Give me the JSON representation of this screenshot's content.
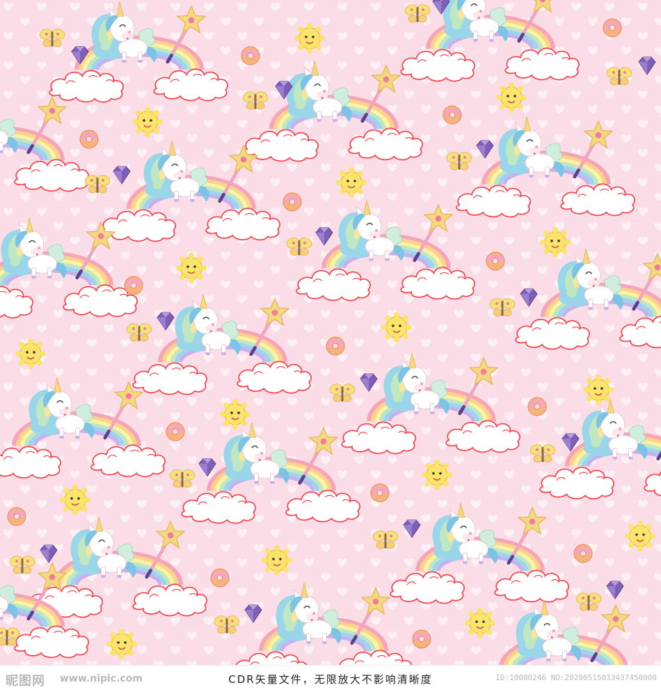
{
  "image": {
    "palette": {
      "background": "#fadde6",
      "heart": "#fdf1f5",
      "cloud_fill": "#ffffff",
      "cloud_outline": "#f04b55",
      "rainbow": [
        "#f7a3b8",
        "#fbd38a",
        "#fdf3a6",
        "#bfe7c2",
        "#9fd3f2",
        "#c6b1ea"
      ],
      "unicorn_body": "#ffffff",
      "mane": [
        "#9ad6e9",
        "#bfe7c2",
        "#f6e79a",
        "#7cc3e6"
      ],
      "star": "#f6d880",
      "sun": "#fbe46b",
      "donut": "#f6b37d",
      "gem": "#7e5fb5",
      "butterfly": "#f7e27a"
    },
    "motifs": [
      "unicorn",
      "rainbow",
      "cloud",
      "magic-wand-star",
      "sun",
      "donut",
      "gem",
      "butterfly",
      "heart"
    ]
  },
  "watermark": {
    "logo": "昵图网",
    "site": "www.nipic.com",
    "note": "CDR矢量文件，无限放大不影响清晰度",
    "id": "ID:10080246 NO:20200515033437450000"
  }
}
